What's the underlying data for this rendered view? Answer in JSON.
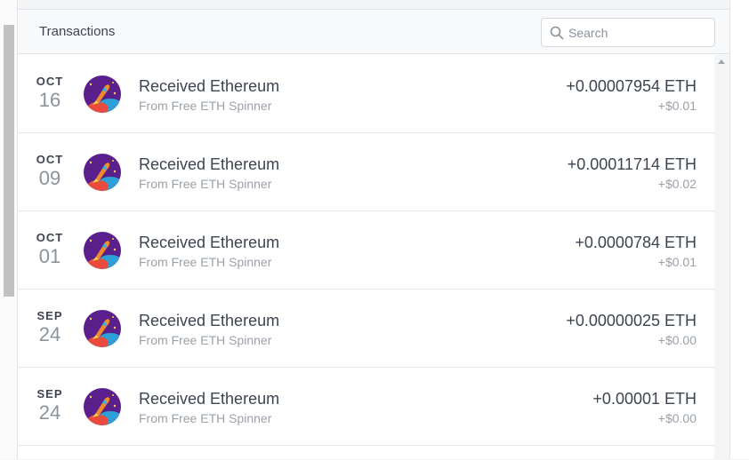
{
  "panel": {
    "title": "Transactions",
    "search": {
      "placeholder": "Search",
      "value": ""
    }
  },
  "transactions": [
    {
      "month": "OCT",
      "day": "16",
      "title": "Received Ethereum",
      "source": "From Free ETH Spinner",
      "amount": "+0.00007954 ETH",
      "fiat": "+$0.01",
      "icon": "rocket-app-icon"
    },
    {
      "month": "OCT",
      "day": "09",
      "title": "Received Ethereum",
      "source": "From Free ETH Spinner",
      "amount": "+0.00011714 ETH",
      "fiat": "+$0.02",
      "icon": "rocket-app-icon"
    },
    {
      "month": "OCT",
      "day": "01",
      "title": "Received Ethereum",
      "source": "From Free ETH Spinner",
      "amount": "+0.0000784 ETH",
      "fiat": "+$0.01",
      "icon": "rocket-app-icon"
    },
    {
      "month": "SEP",
      "day": "24",
      "title": "Received Ethereum",
      "source": "From Free ETH Spinner",
      "amount": "+0.00000025 ETH",
      "fiat": "+$0.00",
      "icon": "rocket-app-icon"
    },
    {
      "month": "SEP",
      "day": "24",
      "title": "Received Ethereum",
      "source": "From Free ETH Spinner",
      "amount": "+0.00001 ETH",
      "fiat": "+$0.00",
      "icon": "rocket-app-icon"
    }
  ],
  "colors": {
    "avatar_bg": "#5b1f8c",
    "rocket": "#f28c28",
    "accent": "#3fb3e0"
  }
}
